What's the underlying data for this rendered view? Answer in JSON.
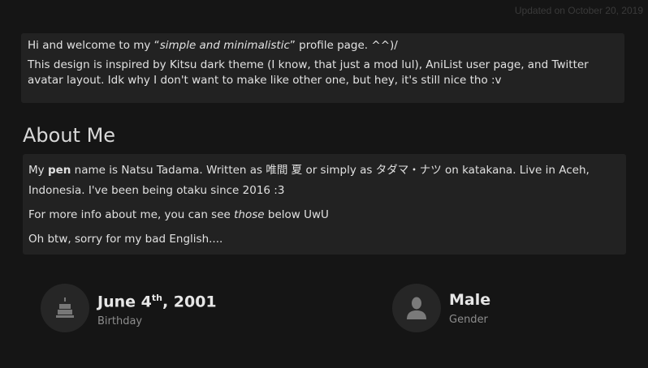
{
  "updated_text": "Updated on October 20, 2019",
  "intro": {
    "line1_prefix": "Hi and welcome to my “",
    "line1_italic": "simple and minimalistic",
    "line1_suffix": "”  profile page. ^^)/",
    "line2": "This design is inspired by Kitsu dark theme (I know, that just a mod lul), AniList user page, and Twitter avatar layout. Idk why I don't want to make like other one, but hey, it's still nice tho :v"
  },
  "about": {
    "title": "About Me",
    "p1_prefix": "My ",
    "p1_bold": "pen",
    "p1_rest": " name is Natsu Tadama. Written as 唯間 夏 or simply as タダマ・ナツ  on katakana. Live in Aceh, Indonesia. I've been being otaku since 2016 :3",
    "p2_prefix": "For more info about me, you can see ",
    "p2_italic": "those",
    "p2_suffix": " below UwU",
    "p3": "Oh btw, sorry for my bad English...."
  },
  "stats": {
    "birthday": {
      "value_prefix": "June 4",
      "value_sup": "th",
      "value_suffix": ", 2001",
      "label": "Birthday",
      "icon": "cake-icon"
    },
    "gender": {
      "value": "Male",
      "label": "Gender",
      "icon": "user-icon"
    }
  },
  "colors": {
    "background": "#151515",
    "panel": "#222222",
    "muted": "#3a3a3a"
  }
}
